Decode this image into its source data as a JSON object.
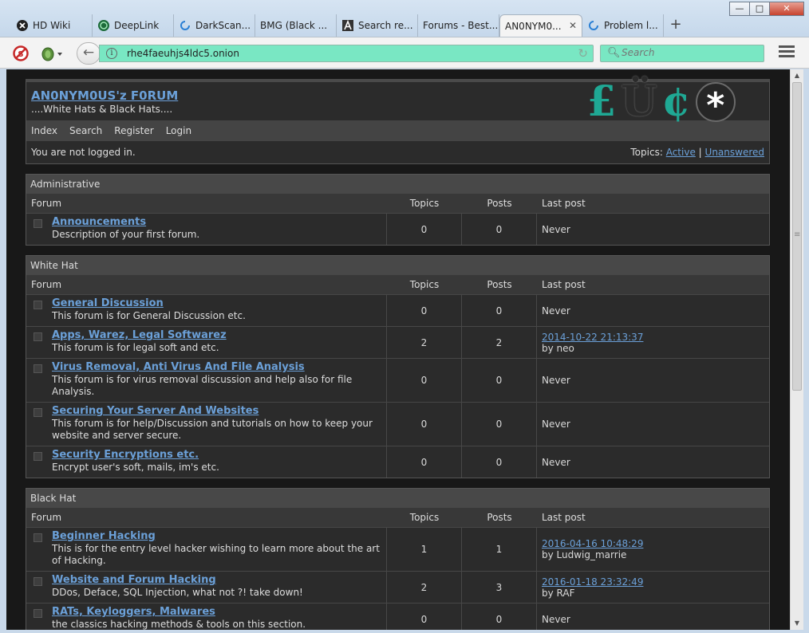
{
  "window": {
    "minimize": "—",
    "maximize": "□",
    "close": "✕"
  },
  "tabs": [
    {
      "label": "HD Wiki",
      "icon": "x-circle-icon"
    },
    {
      "label": "DeepLink",
      "icon": "globe-icon"
    },
    {
      "label": "DarkScan...",
      "icon": "loading-icon"
    },
    {
      "label": "BMG (Black ...",
      "icon": ""
    },
    {
      "label": "Search re...",
      "icon": "a-logo-icon"
    },
    {
      "label": "Forums - Best...",
      "icon": ""
    },
    {
      "label": "AN0NYM0...",
      "icon": ""
    },
    {
      "label": "Problem l...",
      "icon": "loading-icon"
    }
  ],
  "new_tab": "+",
  "toolbar": {
    "url": "rhe4faeuhjs4ldc5.onion",
    "search_placeholder": "Search",
    "back": "←",
    "reload": "↻",
    "info": "i"
  },
  "forum": {
    "title": "AN0NYM0US'z F0RUM",
    "tagline": "....White Hats & Black Hats....",
    "logo": {
      "c1": "£",
      "c2": "Ü",
      "c3": "¢",
      "c4": "*"
    },
    "nav": [
      "Index",
      "Search",
      "Register",
      "Login"
    ],
    "status": "You are not logged in.",
    "topics_label": "Topics:",
    "active": "Active",
    "separator": "|",
    "unanswered": "Unanswered",
    "columns": {
      "forum": "Forum",
      "topics": "Topics",
      "posts": "Posts",
      "last": "Last post"
    },
    "sections": [
      {
        "title": "Administrative",
        "forums": [
          {
            "name": "Announcements",
            "desc": "Description of your first forum.",
            "topics": "0",
            "posts": "0",
            "last": "Never",
            "by": ""
          }
        ]
      },
      {
        "title": "White Hat",
        "forums": [
          {
            "name": "General Discussion",
            "desc": "This forum is for General Discussion etc.",
            "topics": "0",
            "posts": "0",
            "last": "Never",
            "by": ""
          },
          {
            "name": "Apps, Warez, Legal Softwarez",
            "desc": "This forum is for legal soft and etc.",
            "topics": "2",
            "posts": "2",
            "last": "2014-10-22 21:13:37",
            "by": "by neo"
          },
          {
            "name": "Virus Removal, Anti Virus And File Analysis",
            "desc": "This forum is for virus removal discussion and help also for file Analysis.",
            "topics": "0",
            "posts": "0",
            "last": "Never",
            "by": ""
          },
          {
            "name": "Securing Your Server And Websites",
            "desc": "This forum is for help/Discussion and tutorials on how to keep your website and server secure.",
            "topics": "0",
            "posts": "0",
            "last": "Never",
            "by": ""
          },
          {
            "name": "Security Encryptions etc.",
            "desc": "Encrypt user's soft, mails, im's etc.",
            "topics": "0",
            "posts": "0",
            "last": "Never",
            "by": ""
          }
        ]
      },
      {
        "title": "Black Hat",
        "forums": [
          {
            "name": "Beginner Hacking",
            "desc": "This is for the entry level hacker wishing to learn more about the art of Hacking.",
            "topics": "1",
            "posts": "1",
            "last": "2016-04-16 10:48:29",
            "by": "by Ludwig_marrie"
          },
          {
            "name": "Website and Forum Hacking",
            "desc": "DDos, Deface, SQL Injection, what not ?! take down!",
            "topics": "2",
            "posts": "3",
            "last": "2016-01-18 23:32:49",
            "by": "by RAF"
          },
          {
            "name": "RATs, Keyloggers, Malwares",
            "desc": "the classics hacking methods & tools on this section.",
            "topics": "0",
            "posts": "0",
            "last": "Never",
            "by": ""
          }
        ]
      }
    ]
  },
  "colors": {
    "url_bar": "#79e7c3",
    "link": "#6ba0d8",
    "logo_accent": "#1fa894",
    "page_bg": "#181818"
  }
}
